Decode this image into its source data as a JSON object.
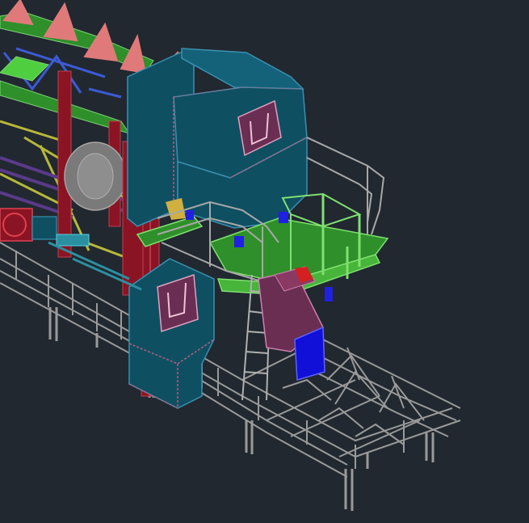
{
  "viewport": {
    "background": "#212830",
    "render_style": "wireframe-shaded-3d"
  },
  "colors": {
    "steel_gray": "#9a9a9a",
    "steel_gray_dark": "#6e6e6e",
    "housing_teal": "#0f4f62",
    "housing_teal_light": "#13627a",
    "door_maroon": "#6a2e52",
    "frame_red": "#8a1424",
    "platform_green": "#2f8f2a",
    "platform_green_light": "#47b43a",
    "truss_salmon": "#e07a7a",
    "bracing_blue": "#3d5ad6",
    "bracing_yellow": "#b8b83a",
    "chute_blue": "#1010d8",
    "chute_purple": "#6a2e52",
    "motor_red": "#d42020",
    "drum_gray": "#7a7a7a",
    "rail_purple": "#5a3a8a"
  },
  "components": [
    "conveyor-truss",
    "main-drive-housing",
    "lower-drive-housing",
    "access-platform",
    "guard-railing",
    "access-ladder",
    "discharge-chute",
    "idler-frame",
    "support-legs",
    "gear-motor",
    "head-pulley-drum"
  ]
}
